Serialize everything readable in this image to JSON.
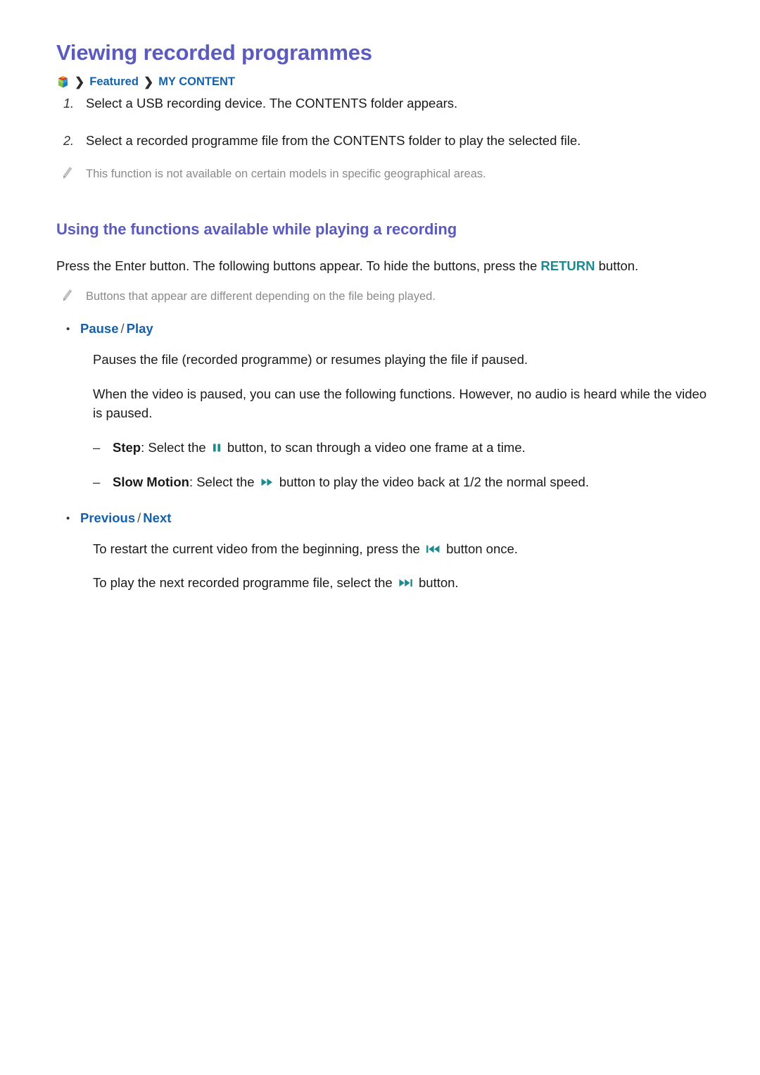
{
  "page": {
    "title": "Viewing recorded programmes",
    "breadcrumb": {
      "home_icon": "smart-hub-cube-icon",
      "separator": "❯",
      "items": [
        "Featured",
        "MY CONTENT"
      ]
    },
    "steps": [
      {
        "num": "1.",
        "text": "Select a USB recording device. The CONTENTS folder appears."
      },
      {
        "num": "2.",
        "text": "Select a recorded programme file from the CONTENTS folder to play the selected file."
      }
    ],
    "note_top": {
      "icon": "pencil-note-icon",
      "text": "This function is not available on certain models in specific geographical areas."
    },
    "section": {
      "heading": "Using the functions available while playing a recording",
      "intro_before": "Press the Enter button. The following buttons appear. To hide the buttons, press the ",
      "intro_key": "RETURN",
      "intro_after": " button.",
      "note": {
        "icon": "pencil-note-icon",
        "text": "Buttons that appear are different depending on the file being played."
      },
      "bullets": [
        {
          "marker": "•",
          "label_first": "Pause",
          "slash": "/",
          "label_second": "Play",
          "paragraphs": [
            "Pauses the file (recorded programme) or resumes playing the file if paused.",
            "When the video is paused, you can use the following functions. However, no audio is heard while the video is paused."
          ],
          "subitems": [
            {
              "mark": "–",
              "term": "Step",
              "before": ": Select the ",
              "icon": "pause-icon",
              "after": " button, to scan through a video one frame at a time."
            },
            {
              "mark": "–",
              "term": "Slow Motion",
              "before": ": Select the ",
              "icon": "fast-forward-icon",
              "after": " button to play the video back at 1/2 the normal speed."
            }
          ]
        },
        {
          "marker": "•",
          "label_first": "Previous",
          "slash": "/",
          "label_second": "Next",
          "lines": [
            {
              "before": "To restart the current video from the beginning, press the ",
              "icon": "skip-previous-icon",
              "after": " button once."
            },
            {
              "before": "To play the next recorded programme file, select the ",
              "icon": "skip-next-icon",
              "after": " button."
            }
          ]
        }
      ]
    },
    "colors": {
      "title_purple": "#5b5bbf",
      "link_blue": "#1461ad",
      "key_teal": "#1b8a91",
      "note_gray": "#8a8a8a",
      "body_black": "#1a1a1a"
    }
  }
}
